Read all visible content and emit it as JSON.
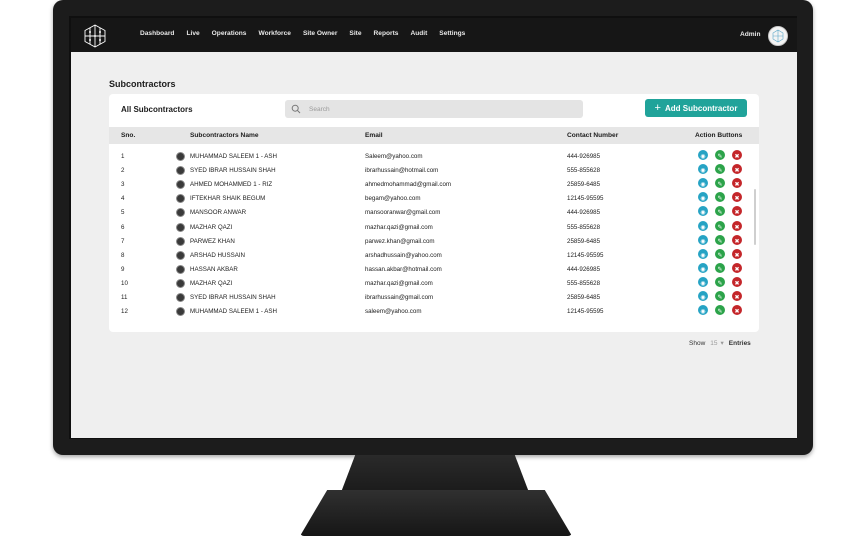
{
  "nav": {
    "items": [
      "Dashboard",
      "Live",
      "Operations",
      "Workforce",
      "Site Owner",
      "Site",
      "Reports",
      "Audit",
      "Settings"
    ],
    "user": "Admin"
  },
  "page": {
    "title": "Subcontractors"
  },
  "card": {
    "title": "All Subcontractors",
    "search_placeholder": "Search",
    "add_button": "Add Subcontractor"
  },
  "table": {
    "columns": [
      "Sno.",
      "Subcontractors Name",
      "Email",
      "Contact Number",
      "Action Buttons"
    ],
    "rows": [
      {
        "sno": "1",
        "name": "MUHAMMAD SALEEM 1 - ASH",
        "email": "Saleem@yahoo.com",
        "contact": "444-926985"
      },
      {
        "sno": "2",
        "name": "SYED IBRAR HUSSAIN SHAH",
        "email": "ibrarhussain@hotmail.com",
        "contact": "555-855628"
      },
      {
        "sno": "3",
        "name": "AHMED MOHAMMED 1 - RIZ",
        "email": "ahmedmohammad@gmail.com",
        "contact": "25859-6485"
      },
      {
        "sno": "4",
        "name": "IFTEKHAR SHAIK BEGUM",
        "email": "begam@yahoo.com",
        "contact": "12145-95595"
      },
      {
        "sno": "5",
        "name": "MANSOOR ANWAR",
        "email": "mansooranwar@gmail.com",
        "contact": "444-926985"
      },
      {
        "sno": "6",
        "name": "MAZHAR QAZI",
        "email": "mazhar.qazi@gmail.com",
        "contact": "555-855628"
      },
      {
        "sno": "7",
        "name": "PARWEZ KHAN",
        "email": "parwez.khan@gmail.com",
        "contact": "25859-6485"
      },
      {
        "sno": "8",
        "name": "ARSHAD HUSSAIN",
        "email": "arshadhussain@yahoo.com",
        "contact": "12145-95595"
      },
      {
        "sno": "9",
        "name": "HASSAN AKBAR",
        "email": "hassan.akbar@hotmail.com",
        "contact": "444-926985"
      },
      {
        "sno": "10",
        "name": "MAZHAR QAZI",
        "email": "mazhar.qazi@gmail.com",
        "contact": "555-855628"
      },
      {
        "sno": "11",
        "name": "SYED IBRAR HUSSAIN SHAH",
        "email": "ibrarhussain@gmail.com",
        "contact": "25859-6485"
      },
      {
        "sno": "12",
        "name": "MUHAMMAD SALEEM 1 - ASH",
        "email": "saleem@yahoo.com",
        "contact": "12145-95595"
      }
    ]
  },
  "footer": {
    "show": "Show",
    "entries_value": "15",
    "entries": "Entries"
  },
  "colors": {
    "accent": "#20a39a",
    "view": "#26a3c4",
    "edit": "#2ca34a",
    "delete": "#c4262a",
    "topbar": "#161616"
  },
  "icons": [
    "logo-icon",
    "avatar-logo-icon",
    "search-icon",
    "plus-icon",
    "eye-icon",
    "pencil-icon",
    "trash-icon",
    "chevron-down-icon"
  ]
}
